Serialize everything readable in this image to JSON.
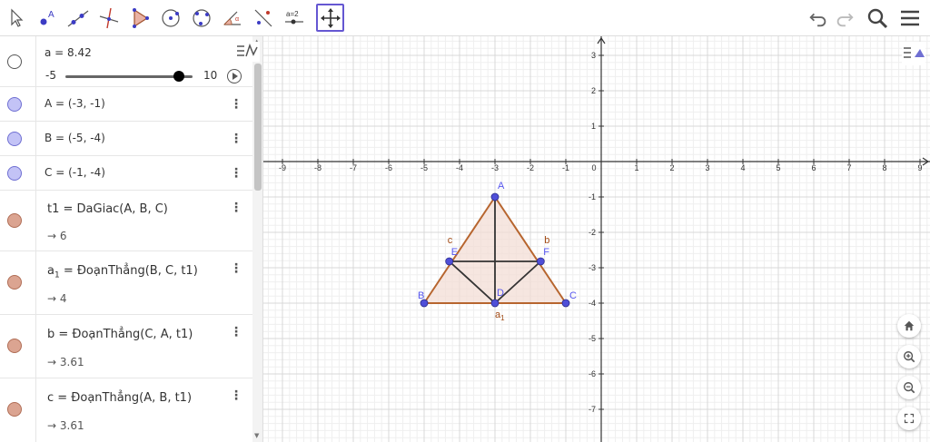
{
  "toolbar": {
    "tools": [
      "move-tool",
      "point-tool",
      "segment-tool",
      "perpendicular-line-tool",
      "polygon-tool",
      "circle-tool",
      "circle-through-points-tool",
      "angle-tool",
      "reflect-tool",
      "slider-tool",
      "move-graphics-tool"
    ],
    "slider_tool_label": "a=2",
    "point_tool_label": "A"
  },
  "algebra": {
    "slider": {
      "def": "a = 8.42",
      "min": "-5",
      "max": "10",
      "value_fraction": 0.895
    },
    "items": [
      {
        "def": "A = (-3, -1)",
        "color": "blue"
      },
      {
        "def": "B = (-5, -4)",
        "color": "blue"
      },
      {
        "def": "C = (-1, -4)",
        "color": "blue"
      },
      {
        "def": "t1 = DaGiac(A, B, C)",
        "value": "→ 6",
        "color": "brown"
      },
      {
        "def_main": "a",
        "def_sub": "1",
        "def_rest": " = ĐoạnThẳng(B, C, t1)",
        "value": "→ 4",
        "color": "brown"
      },
      {
        "def": "b = ĐoạnThẳng(C, A, t1)",
        "value": "→ 3.61",
        "color": "brown"
      },
      {
        "def": "c = ĐoạnThẳng(A, B, t1)",
        "value": "→ 3.61",
        "color": "brown"
      }
    ]
  },
  "graph": {
    "x_ticks": [
      "-9",
      "-8",
      "-7",
      "-6",
      "-5",
      "-4",
      "-3",
      "-2",
      "-1",
      "0",
      "1",
      "2",
      "3",
      "4",
      "5",
      "6",
      "7",
      "8",
      "9"
    ],
    "y_ticks": [
      "3",
      "2",
      "1",
      "-1",
      "-2",
      "-3",
      "-4",
      "-5",
      "-6",
      "-7"
    ],
    "points": {
      "A": {
        "label": "A",
        "x": -3,
        "y": -1
      },
      "B": {
        "label": "B",
        "x": -5,
        "y": -4
      },
      "C": {
        "label": "C",
        "x": -1,
        "y": -4
      },
      "D": {
        "label": "D",
        "x": -3,
        "y": -4
      },
      "E": {
        "label": "E",
        "x": -4.29,
        "y": -2.82
      },
      "F": {
        "label": "F",
        "x": -1.71,
        "y": -2.82
      }
    },
    "segment_labels": {
      "a1_main": "a",
      "a1_sub": "1",
      "b": "b",
      "c": "c"
    },
    "colors": {
      "triangle_stroke": "#b7652e",
      "triangle_fill": "#f3ddd6",
      "point_fill": "#4f4fd8",
      "point_label": "#5656ee",
      "segment_dark": "#333333"
    }
  }
}
